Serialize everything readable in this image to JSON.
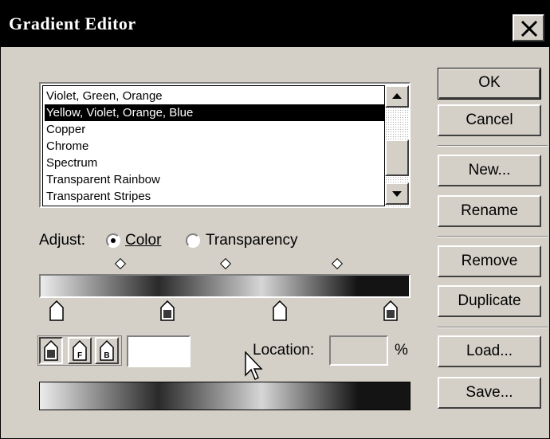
{
  "window": {
    "title": "Gradient Editor"
  },
  "gradients": {
    "items": [
      "Violet, Green, Orange",
      "Yellow, Violet, Orange, Blue",
      "Copper",
      "Chrome",
      "Spectrum",
      "Transparent Rainbow",
      "Transparent Stripes"
    ],
    "selected": "Yellow, Violet, Orange, Blue"
  },
  "adjust": {
    "label": "Adjust:",
    "options": [
      "Color",
      "Transparency"
    ],
    "selected": "Color"
  },
  "stop_type_buttons": {
    "foreground_letter": "F",
    "background_letter": "B"
  },
  "location": {
    "label": "Location:",
    "value": "",
    "unit": "%"
  },
  "buttons": {
    "ok": "OK",
    "cancel": "Cancel",
    "new": "New...",
    "rename": "Rename",
    "remove": "Remove",
    "duplicate": "Duplicate",
    "load": "Load...",
    "save": "Save..."
  }
}
